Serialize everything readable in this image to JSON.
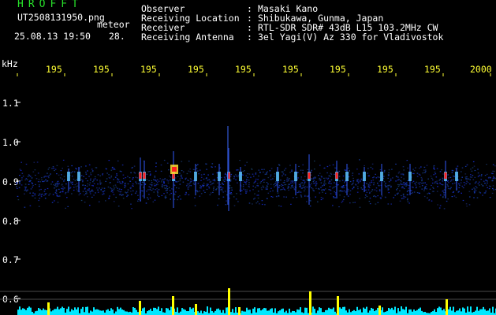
{
  "header": {
    "logo": "HROFFT",
    "filename": "UT2508131950.png",
    "meteor_label": "meteor",
    "datetime": "25.08.13 19:50",
    "count": "28.",
    "fields": [
      {
        "label": "Observer",
        "value": "Masaki Kano"
      },
      {
        "label": "Receiving Location",
        "value": "Shibukawa, Gunma, Japan"
      },
      {
        "label": "Receiver",
        "value": "RTL-SDR SDR# 43dB L15 103.2MHz CW"
      },
      {
        "label": "Receiving Antenna",
        "value": "3el Yagi(V) Az 330 for Vladivostok"
      }
    ]
  },
  "axes": {
    "y_unit": "kHz",
    "y_ticks": [
      "1.1",
      "1.0",
      "0.9",
      "0.8",
      "0.7",
      "0.6"
    ],
    "x_ticks": [
      "195",
      "195",
      "195",
      "195",
      "195",
      "195",
      "195",
      "195",
      "195",
      "2000"
    ]
  },
  "colors": {
    "background": "#000000",
    "text": "#ffffff",
    "logo": "#27e02a",
    "ticks": "#ffff33",
    "noise_band": "#1a2aa0",
    "meteor_hot": "#ff2020",
    "histogram": "#00e8ff",
    "histogram_peak": "#ffff00"
  }
}
